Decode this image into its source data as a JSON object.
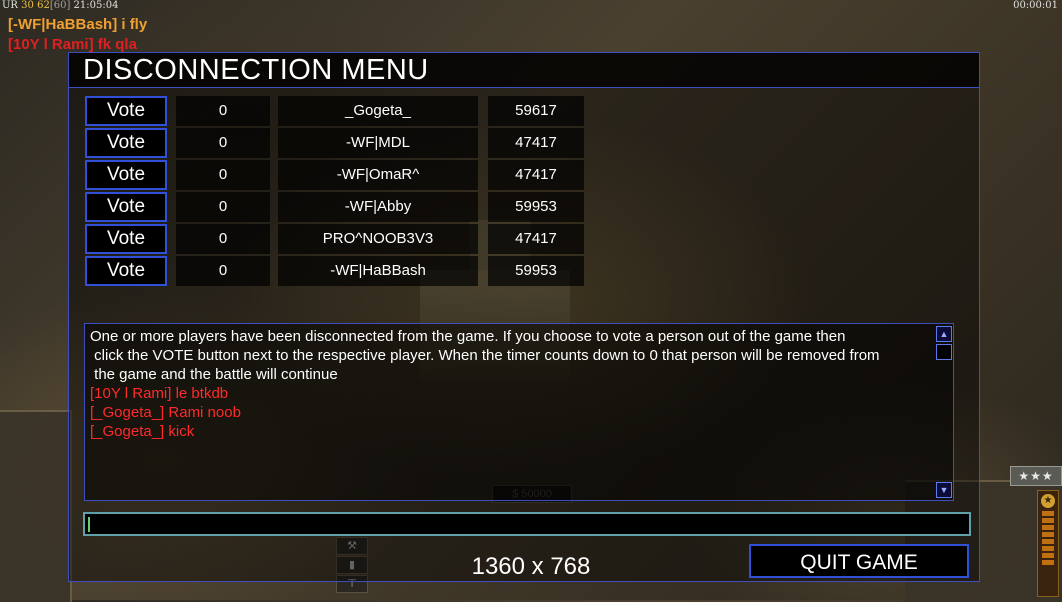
{
  "hud": {
    "left_prefix": "UR",
    "left_a": "30",
    "left_b": "62",
    "left_c": "[60]",
    "left_time": "21:05:04",
    "right_time": "00:00:01"
  },
  "ingame_chat": [
    {
      "text": "[-WF|HaBBash] i fly"
    },
    {
      "text": "[10Y l Rami] fk qla"
    }
  ],
  "dialog": {
    "title": "DISCONNECTION MENU",
    "vote_label": "Vote",
    "players": [
      {
        "votes": "0",
        "name": "_Gogeta_",
        "ping": "59617"
      },
      {
        "votes": "0",
        "name": "-WF|MDL",
        "ping": "47417"
      },
      {
        "votes": "0",
        "name": "-WF|OmaR^",
        "ping": "47417"
      },
      {
        "votes": "0",
        "name": "-WF|Abby",
        "ping": "59953"
      },
      {
        "votes": "0",
        "name": "PRO^NOOB3V3",
        "ping": "47417"
      },
      {
        "votes": "0",
        "name": "-WF|HaBBash",
        "ping": "59953"
      }
    ],
    "info_text_1": "One or more players have been disconnected from the game. If you choose to vote a person out of the game then",
    "info_text_2": " click the VOTE button next to the respective player. When the timer counts down to 0 that person will be removed from",
    "info_text_3": " the game and the battle will continue",
    "chat_messages": [
      "[10Y l Rami] le btkdb",
      "[_Gogeta_] Rami noob",
      "[_Gogeta_] kick"
    ],
    "chat_input_value": "",
    "resolution": "1360 x 768",
    "quit_label": "QUIT GAME"
  },
  "game_ui": {
    "cash": "$ 50000",
    "rank_stars": "★★★"
  },
  "colors": {
    "accent_border": "#3d4fbf",
    "chat_red": "#ff2a2a",
    "chat_orange": "#f0a030"
  }
}
